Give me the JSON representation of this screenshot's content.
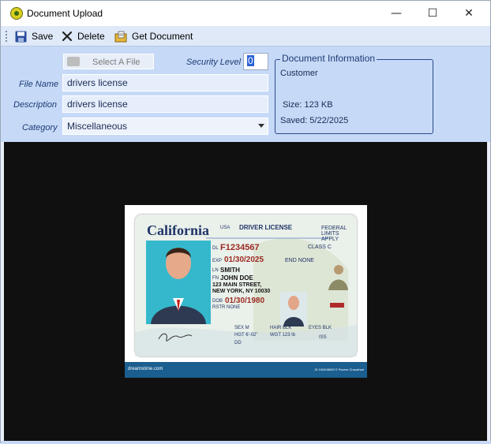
{
  "window": {
    "title": "Document Upload",
    "controls": {
      "minimize": "—",
      "maximize": "☐",
      "close": "✕"
    }
  },
  "toolbar": {
    "save_label": "Save",
    "delete_label": "Delete",
    "get_document_label": "Get Document"
  },
  "form": {
    "select_file_label": "Select A File",
    "security_level_label": "Security Level",
    "security_level_value": "0",
    "file_name_label": "File Name",
    "file_name_value": "drivers license",
    "description_label": "Description",
    "description_value": "drivers license",
    "category_label": "Category",
    "category_value": "Miscellaneous"
  },
  "document_info": {
    "legend": "Document Information",
    "owner": "Customer",
    "size": "Size: 123 KB",
    "saved": "Saved: 5/22/2025"
  },
  "preview_card": {
    "state": "California",
    "country": "USA",
    "doc_type": "DRIVER LICENSE",
    "federal_line1": "FEDERAL",
    "federal_line2": "LIMITS",
    "federal_line3": "APPLY",
    "dl_label": "DL",
    "dl_value": "F1234567",
    "class_label": "CLASS C",
    "exp_label": "EXP",
    "exp_value": "01/30/2025",
    "end_label": "END NONE",
    "ln_label": "LN",
    "ln_value": "SMITH",
    "fn_label": "FN",
    "fn_value": "JOHN DOE",
    "address1": "123 MAIN STREET,",
    "address2": "NEW YORK, NY 10030",
    "dob_label": "DOB",
    "dob_value": "01/30/1980",
    "rstr": "RSTR NONE",
    "sex": "SEX  M",
    "hair": "HAIR  BLK",
    "eyes": "EYES  BLK",
    "hgt": "HGT  6'-02\"",
    "wgt": "WGT  123 lb",
    "iss": "ISS",
    "dd": "DD",
    "footer_left": "dreamstime.com",
    "footer_right": "ID 190408628 © Paurex Chaudhari"
  },
  "colors": {
    "form_bg": "#c6daf7",
    "toolbar_bg": "#dfe9f8",
    "viewer_bg": "#101010",
    "accent": "#2d63d4"
  }
}
